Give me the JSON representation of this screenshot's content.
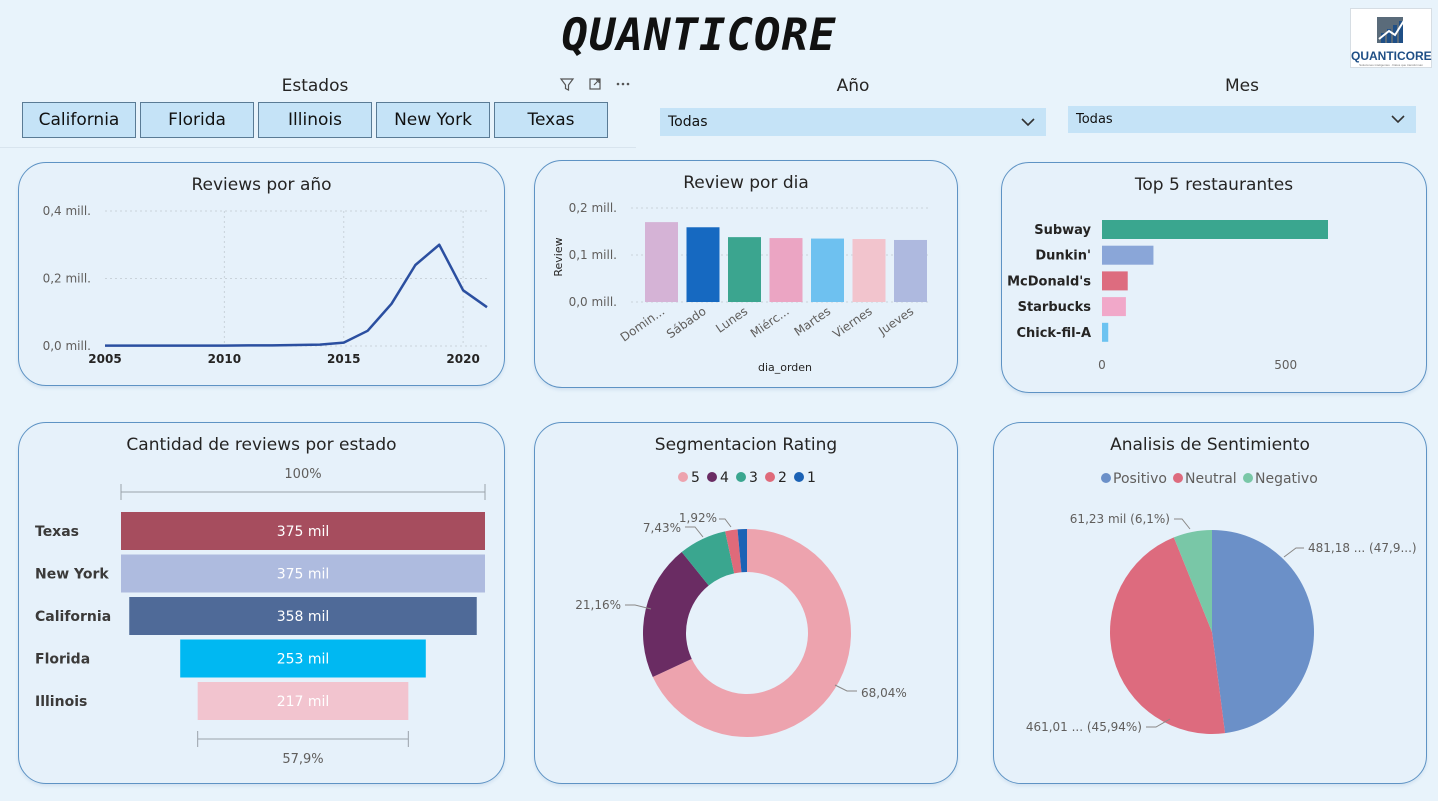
{
  "header": {
    "title": "QUANTICORE",
    "logo_text": "QUANTICORE",
    "logo_subtext": "Soluciones inteligentes · Datos que transforman"
  },
  "filters": {
    "estados": {
      "title": "Estados",
      "options": [
        "California",
        "Florida",
        "Illinois",
        "New York",
        "Texas"
      ]
    },
    "anio": {
      "title": "Año",
      "value": "Todas"
    },
    "mes": {
      "title": "Mes",
      "value": "Todas"
    }
  },
  "visual_icons": [
    "filter-icon",
    "focus-mode-icon",
    "more-options-icon"
  ],
  "charts": {
    "reviews_por_anio": {
      "title": "Reviews por año",
      "y_ticks": [
        "0,4 mill.",
        "0,2 mill.",
        "0,0 mill."
      ],
      "x_ticks": [
        "2005",
        "2010",
        "2015",
        "2020"
      ],
      "color": "#2b4fa0"
    },
    "review_por_dia": {
      "title": "Review por dia",
      "ylabel": "Review",
      "xlabel": "dia_orden",
      "y_ticks": [
        "0,2 mill.",
        "0,1 mill.",
        "0,0 mill."
      ]
    },
    "top5": {
      "title": "Top 5 restaurantes",
      "x_ticks": [
        "0",
        "500"
      ]
    },
    "funnel": {
      "title": "Cantidad de reviews por estado",
      "top_pct": "100%",
      "bottom_pct": "57,9%"
    },
    "rating": {
      "title": "Segmentacion Rating"
    },
    "sentimiento": {
      "title": "Analisis de Sentimiento"
    }
  },
  "chart_data": [
    {
      "type": "line",
      "title": "Reviews por año",
      "x": [
        2005,
        2006,
        2007,
        2008,
        2009,
        2010,
        2011,
        2012,
        2013,
        2014,
        2015,
        2016,
        2017,
        2018,
        2019,
        2020,
        2021
      ],
      "values": [
        0.001,
        0.001,
        0.001,
        0.001,
        0.001,
        0.001,
        0.002,
        0.002,
        0.003,
        0.004,
        0.01,
        0.045,
        0.125,
        0.24,
        0.3,
        0.165,
        0.115
      ],
      "ylim": [
        0,
        0.4
      ],
      "unit": "mill."
    },
    {
      "type": "bar",
      "title": "Review por dia",
      "categories": [
        "Domin...",
        "Sábado",
        "Lunes",
        "Miérc...",
        "Martes",
        "Viernes",
        "Jueves"
      ],
      "values": [
        0.17,
        0.159,
        0.138,
        0.136,
        0.135,
        0.134,
        0.132
      ],
      "colors": [
        "#d5b3d6",
        "#1669c1",
        "#3ba58f",
        "#eba5c3",
        "#6ec1f0",
        "#f2c4cd",
        "#aeb9df"
      ],
      "ylim": [
        0,
        0.2
      ],
      "xlabel": "dia_orden",
      "ylabel": "Review"
    },
    {
      "type": "bar",
      "orientation": "horizontal",
      "title": "Top 5 restaurantes",
      "categories": [
        "Subway",
        "Dunkin'",
        "McDonald's",
        "Starbucks",
        "Chick-fil-A"
      ],
      "values": [
        615,
        140,
        70,
        65,
        17
      ],
      "colors": [
        "#3aa68f",
        "#8aa6d8",
        "#dd6c7f",
        "#f1a8c9",
        "#6cc3f1"
      ],
      "xlim": [
        0,
        700
      ]
    },
    {
      "type": "bar",
      "orientation": "funnel",
      "title": "Cantidad de reviews por estado",
      "categories": [
        "Texas",
        "New York",
        "California",
        "Florida",
        "Illinois"
      ],
      "values": [
        375,
        375,
        358,
        253,
        217
      ],
      "labels": [
        "375 mil",
        "375 mil",
        "358 mil",
        "253 mil",
        "217 mil"
      ],
      "colors": [
        "#a64d5e",
        "#aebbdf",
        "#4f6a98",
        "#00b8f2",
        "#f2c4cf"
      ]
    },
    {
      "type": "pie",
      "subtype": "donut",
      "title": "Segmentacion Rating",
      "categories": [
        "5",
        "4",
        "3",
        "2",
        "1"
      ],
      "values": [
        68.04,
        21.16,
        7.43,
        1.92,
        1.45
      ],
      "labels": [
        "68,04%",
        "21,16%",
        "7,43%",
        "1,92%",
        ""
      ],
      "colors": [
        "#eda3ae",
        "#6a2c63",
        "#3aa68f",
        "#df6a7a",
        "#1b62b5"
      ]
    },
    {
      "type": "pie",
      "title": "Analisis de Sentimiento",
      "categories": [
        "Positivo",
        "Neutral",
        "Negativo"
      ],
      "values": [
        47.96,
        45.94,
        6.1
      ],
      "labels": [
        "481,18 ... (47,9...)",
        "461,01 ... (45,94%)",
        "61,23 mil (6,1%)"
      ],
      "colors": [
        "#6b90c8",
        "#dd6b7e",
        "#79c7a7"
      ]
    }
  ]
}
